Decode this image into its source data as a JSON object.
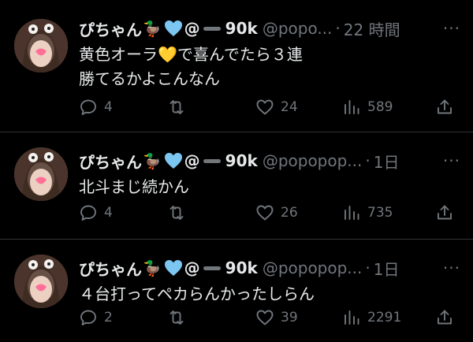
{
  "colors": {
    "background": "#000000",
    "text_primary": "#e7e9ea",
    "text_secondary": "#71767b",
    "divider": "#2f3336",
    "heart_blue": "#7cc7f2"
  },
  "icons": {
    "more": "three-dots-icon",
    "reply": "speech-bubble-icon",
    "retweet": "retweet-arrows-icon",
    "like": "heart-outline-icon",
    "views": "bar-chart-icon",
    "share": "share-up-arrow-icon"
  },
  "tweets": [
    {
      "display_name": "ぴちゃん",
      "name_emojis": "🦆",
      "name_suffix": "@",
      "follower_tag": "90k",
      "handle": "@popo...",
      "dot": "·",
      "time": "22 時間",
      "more": "···",
      "text_lines": [
        "黄色オーラ💛で喜んでたら３連",
        "勝てるかよこんなん"
      ],
      "replies": "4",
      "retweets": "",
      "likes": "24",
      "views": "589"
    },
    {
      "display_name": "ぴちゃん",
      "name_emojis": "🦆",
      "name_suffix": "@",
      "follower_tag": "90k",
      "handle": "@popopop...",
      "dot": "·",
      "time": "1日",
      "more": "···",
      "text_lines": [
        "北斗まじ続かん"
      ],
      "replies": "4",
      "retweets": "",
      "likes": "26",
      "views": "735"
    },
    {
      "display_name": "ぴちゃん",
      "name_emojis": "🦆",
      "name_suffix": "@",
      "follower_tag": "90k",
      "handle": "@popopop...",
      "dot": "·",
      "time": "1日",
      "more": "···",
      "text_lines": [
        "４台打ってペカらんかったしらん"
      ],
      "replies": "2",
      "retweets": "",
      "likes": "39",
      "views": "2291"
    }
  ]
}
